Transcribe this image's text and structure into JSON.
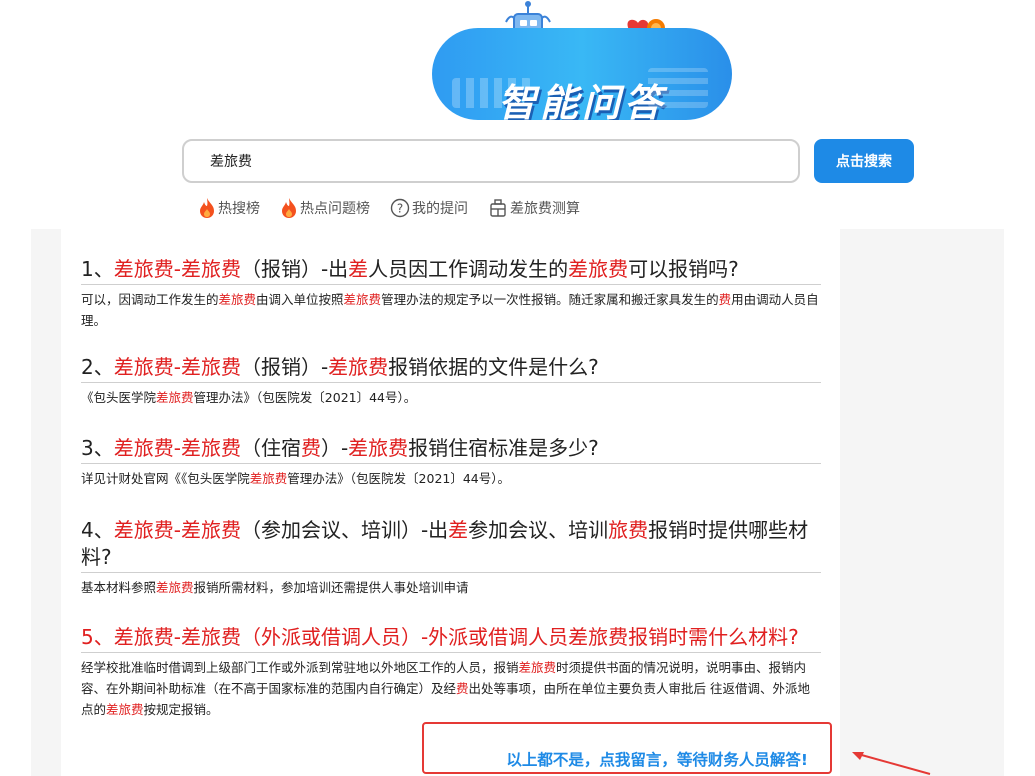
{
  "banner": {
    "title": "智能问答"
  },
  "search": {
    "value": "差旅费",
    "button_label": "点击搜索"
  },
  "quicklinks": [
    {
      "label": "热搜榜",
      "icon": "flame-icon"
    },
    {
      "label": "热点问题榜",
      "icon": "flame-icon"
    },
    {
      "label": "我的提问",
      "icon": "question-circle-icon"
    },
    {
      "label": "差旅费测算",
      "icon": "calculator-icon"
    }
  ],
  "results": [
    {
      "title_parts": [
        {
          "t": "1、",
          "hl": false
        },
        {
          "t": "差旅费-差旅费",
          "hl": true
        },
        {
          "t": "（报销）-出",
          "hl": false
        },
        {
          "t": "差",
          "hl": true
        },
        {
          "t": "人员因工作调动发生的",
          "hl": false
        },
        {
          "t": "差旅费",
          "hl": true
        },
        {
          "t": "可以报销吗?",
          "hl": false
        }
      ],
      "answer_parts": [
        {
          "t": "可以，因调动工作发生的",
          "hl": false
        },
        {
          "t": "差旅费",
          "hl": true
        },
        {
          "t": "由调入单位按照",
          "hl": false
        },
        {
          "t": "差旅费",
          "hl": true
        },
        {
          "t": "管理办法的规定予以一次性报销。随迁家属和搬迁家具发生的",
          "hl": false
        },
        {
          "t": "费",
          "hl": true
        },
        {
          "t": "用由调动人员自理。",
          "hl": false
        }
      ]
    },
    {
      "title_parts": [
        {
          "t": "2、",
          "hl": false
        },
        {
          "t": "差旅费-差旅费",
          "hl": true
        },
        {
          "t": "（报销）-",
          "hl": false
        },
        {
          "t": "差旅费",
          "hl": true
        },
        {
          "t": "报销依据的文件是什么?",
          "hl": false
        }
      ],
      "answer_parts": [
        {
          "t": "《包头医学院",
          "hl": false
        },
        {
          "t": "差旅费",
          "hl": true
        },
        {
          "t": "管理办法》（包医院发〔2021〕44号）。",
          "hl": false
        }
      ]
    },
    {
      "title_parts": [
        {
          "t": "3、",
          "hl": false
        },
        {
          "t": "差旅费-差旅费",
          "hl": true
        },
        {
          "t": "（住宿",
          "hl": false
        },
        {
          "t": "费",
          "hl": true
        },
        {
          "t": "）-",
          "hl": false
        },
        {
          "t": "差旅费",
          "hl": true
        },
        {
          "t": "报销住宿标准是多少?",
          "hl": false
        }
      ],
      "answer_parts": [
        {
          "t": "详见计财处官网《《包头医学院",
          "hl": false
        },
        {
          "t": "差旅费",
          "hl": true
        },
        {
          "t": "管理办法》（包医院发〔2021〕44号）。",
          "hl": false
        }
      ]
    },
    {
      "title_parts": [
        {
          "t": "4、",
          "hl": false
        },
        {
          "t": "差旅费-差旅费",
          "hl": true
        },
        {
          "t": "（参加会议、培训）-出",
          "hl": false
        },
        {
          "t": "差",
          "hl": true
        },
        {
          "t": "参加会议、培训",
          "hl": false
        },
        {
          "t": "旅费",
          "hl": true
        },
        {
          "t": "报销时提供哪些材料?",
          "hl": false
        }
      ],
      "answer_parts": [
        {
          "t": "基本材料参照",
          "hl": false
        },
        {
          "t": "差旅费",
          "hl": true
        },
        {
          "t": "报销所需材料，参加培训还需提供人事处培训申请",
          "hl": false
        }
      ]
    },
    {
      "title_parts": [
        {
          "t": "5、差旅费-差旅费（外派或借调人员）-外派或借调人员差旅费报销时需什么材料?",
          "hl": true
        }
      ],
      "answer_parts": [
        {
          "t": "经学校批准临时借调到上级部门工作或外派到常驻地以外地区工作的人员，报销",
          "hl": false
        },
        {
          "t": "差旅费",
          "hl": true
        },
        {
          "t": "时须提供书面的情况说明，说明事由、报销内容、在外期间补助标准（在不高于国家标准的范围内自行确定）及经",
          "hl": false
        },
        {
          "t": "费",
          "hl": true
        },
        {
          "t": "出处等事项，由所在单位主要负责人审批后 往返借调、外派地点的",
          "hl": false
        },
        {
          "t": "差旅费",
          "hl": true
        },
        {
          "t": "按规定报销。",
          "hl": false
        }
      ]
    }
  ],
  "leave_message": {
    "label": "以上都不是，点我留言，等待财务人员解答!"
  },
  "colors": {
    "highlight": "#e02020",
    "accent": "#1e8ae6",
    "annotation": "#e53935"
  }
}
